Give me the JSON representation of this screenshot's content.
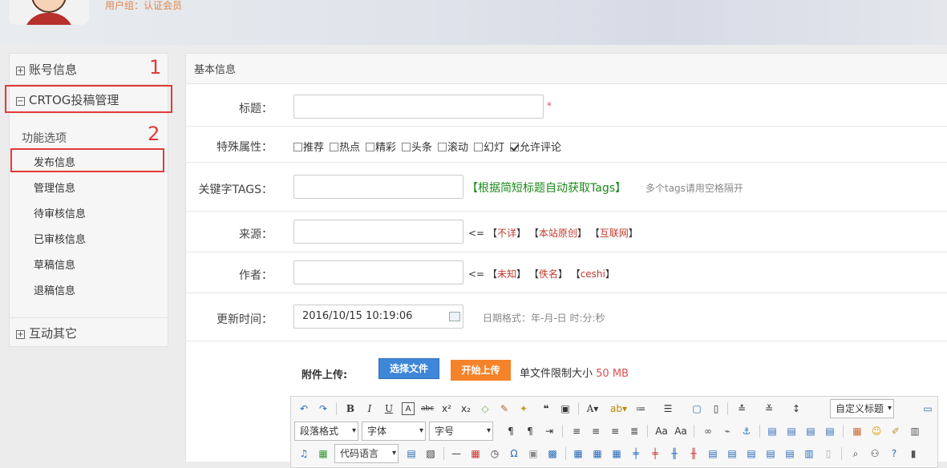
{
  "header": {
    "usergroup": "用户组：认证会员"
  },
  "sidebar": {
    "account": {
      "toggle": "⊞",
      "label": "账号信息"
    },
    "crtog": {
      "toggle": "⊟",
      "label": "CRTOG投稿管理"
    },
    "section_title": "功能选项",
    "items": [
      "发布信息",
      "管理信息",
      "待审核信息",
      "已审核信息",
      "草稿信息",
      "退稿信息"
    ],
    "other": {
      "toggle": "⊞",
      "label": "互动其它"
    }
  },
  "annotations": {
    "one": "1",
    "two": "2"
  },
  "form": {
    "section_title": "基本信息",
    "title_label": "标题：",
    "required_mark": "*",
    "attr_label": "特殊属性：",
    "attrs": [
      {
        "label": "推荐",
        "checked": false
      },
      {
        "label": "热点",
        "checked": false
      },
      {
        "label": "精彩",
        "checked": false
      },
      {
        "label": "头条",
        "checked": false
      },
      {
        "label": "滚动",
        "checked": false
      },
      {
        "label": "幻灯",
        "checked": false
      },
      {
        "label": "允许评论",
        "checked": true
      }
    ],
    "keywords_label": "关键字TAGS：",
    "keywords_auto": "【根据简短标题自动获取Tags】",
    "keywords_hint": "多个tags请用空格隔开",
    "source_label": "来源：",
    "source_prefix": "<=",
    "source_options": [
      "不详",
      "本站原创",
      "互联网"
    ],
    "author_label": "作者：",
    "author_prefix": "<=",
    "author_options": [
      "未知",
      "佚名",
      "ceshi"
    ],
    "update_label": "更新时间：",
    "update_value": "2016/10/15 10:19:06",
    "update_hint": "日期格式：年-月-日 时:分:秒",
    "upload_label": "附件上传:",
    "choose_file": "选择文件",
    "start_upload": "开始上传",
    "size_text": "单文件限制大小",
    "size_value": "50 MB"
  },
  "editor": {
    "custom_heading": "自定义标题",
    "paragraph": "段落格式",
    "font": "字体",
    "size": "字号",
    "code_lang": "代码语言"
  }
}
